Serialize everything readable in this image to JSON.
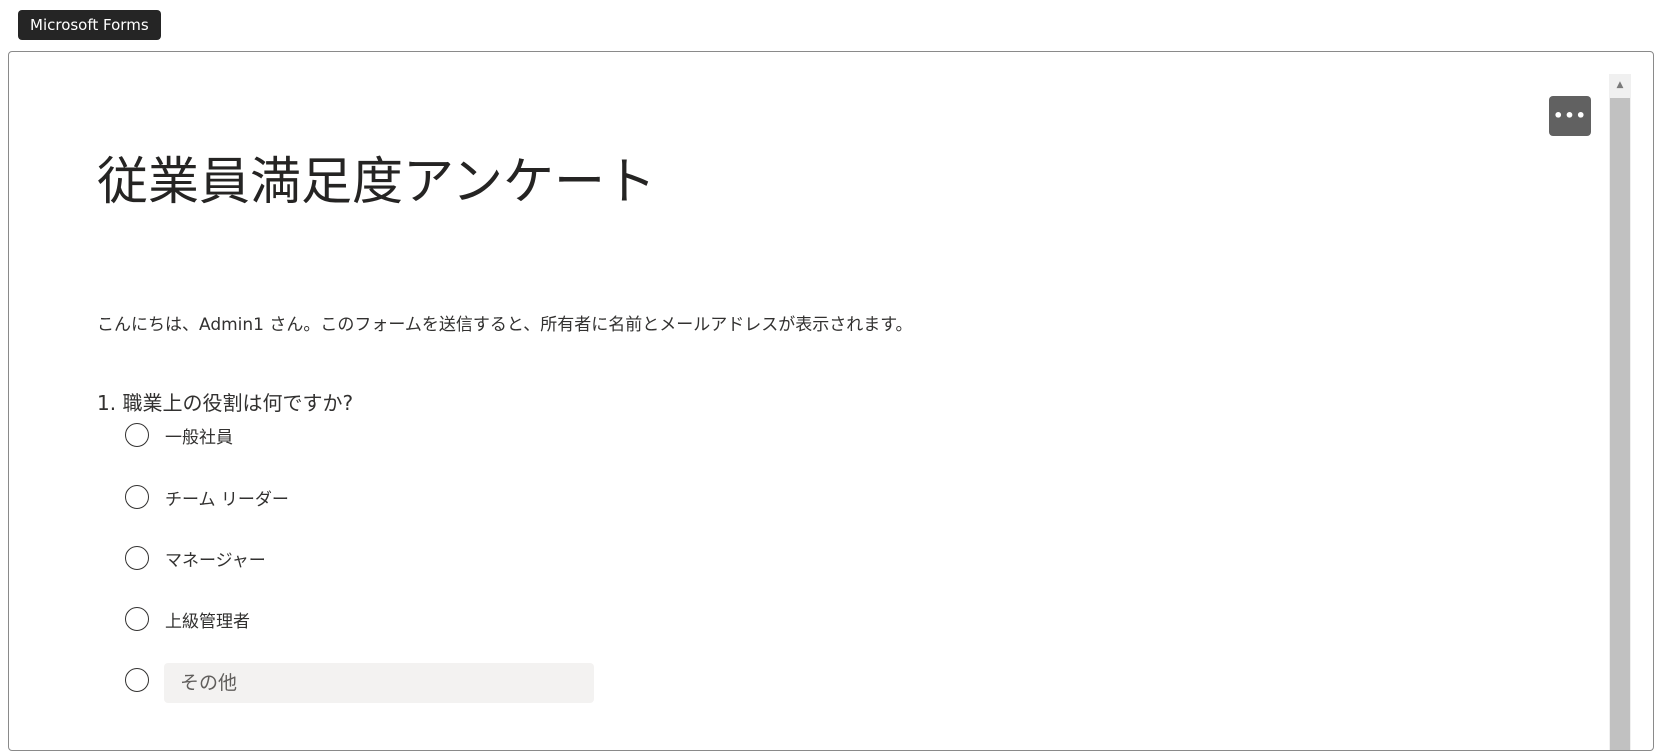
{
  "app": {
    "badge_label": "Microsoft Forms"
  },
  "toolbar": {
    "more_label": "•••"
  },
  "scrollbar": {
    "up_arrow": "▲"
  },
  "form": {
    "title": "従業員満足度アンケート",
    "intro": "こんにちは、Admin1 さん。このフォームを送信すると、所有者に名前とメールアドレスが表示されます。"
  },
  "question1": {
    "title": "1. 職業上の役割は何ですか?",
    "options": [
      "一般社員",
      "チーム リーダー",
      "マネージャー",
      "上級管理者"
    ],
    "other_placeholder": "その他"
  }
}
